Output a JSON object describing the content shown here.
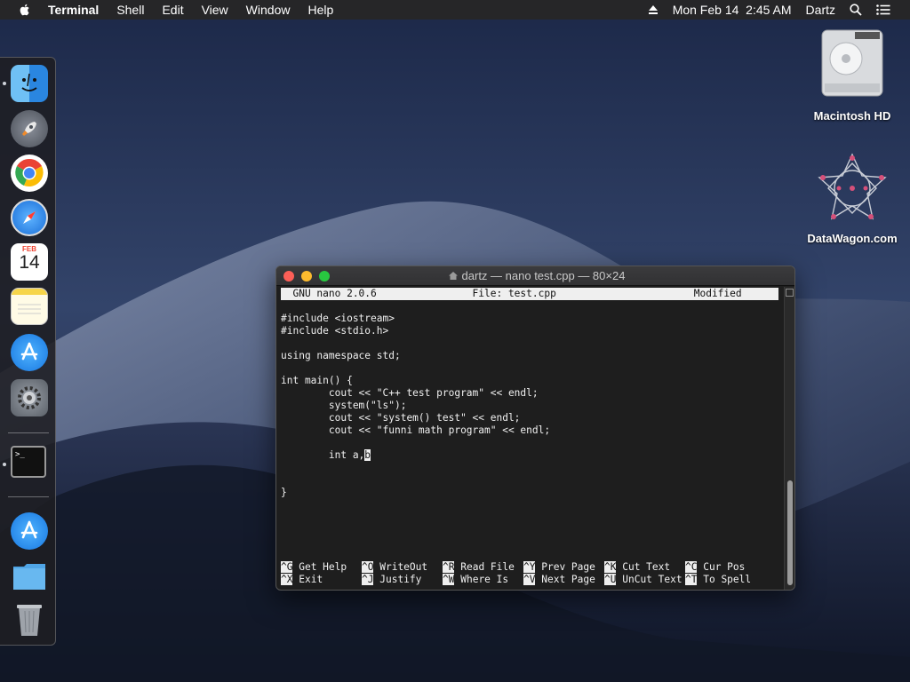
{
  "menubar": {
    "app": "Terminal",
    "items": [
      "Shell",
      "Edit",
      "View",
      "Window",
      "Help"
    ],
    "clock": "Mon Feb 14  2:45 AM",
    "user": "Dartz"
  },
  "desktop": {
    "icons": [
      {
        "label": "Macintosh HD"
      },
      {
        "label": "DataWagon.com"
      }
    ]
  },
  "dock": {
    "calendar_month": "FEB",
    "calendar_day": "14",
    "terminal_glyph": ">_"
  },
  "window": {
    "title": "dartz — nano test.cpp — 80×24"
  },
  "nano": {
    "header": "  GNU nano 2.0.6                File: test.cpp                       Modified ",
    "code": [
      "#include <iostream>",
      "#include <stdio.h>",
      "",
      "using namespace std;",
      "",
      "int main() {",
      "        cout << \"C++ test program\" << endl;",
      "        system(\"ls\");",
      "        cout << \"system() test\" << endl;",
      "        cout << \"funni math program\" << endl;",
      "",
      "        int a,"
    ],
    "cursor_char": "b",
    "closing_brace": "}",
    "shortcuts_row1": [
      {
        "key": "^G",
        "label": "Get Help"
      },
      {
        "key": "^O",
        "label": "WriteOut"
      },
      {
        "key": "^R",
        "label": "Read File"
      },
      {
        "key": "^Y",
        "label": "Prev Page"
      },
      {
        "key": "^K",
        "label": "Cut Text"
      },
      {
        "key": "^C",
        "label": "Cur Pos"
      }
    ],
    "shortcuts_row2": [
      {
        "key": "^X",
        "label": "Exit"
      },
      {
        "key": "^J",
        "label": "Justify"
      },
      {
        "key": "^W",
        "label": "Where Is"
      },
      {
        "key": "^V",
        "label": "Next Page"
      },
      {
        "key": "^U",
        "label": "UnCut Text"
      },
      {
        "key": "^T",
        "label": "To Spell"
      }
    ]
  },
  "colors": {
    "close": "#fc5f57",
    "minimize": "#fdbb2e",
    "zoom": "#28c840"
  }
}
